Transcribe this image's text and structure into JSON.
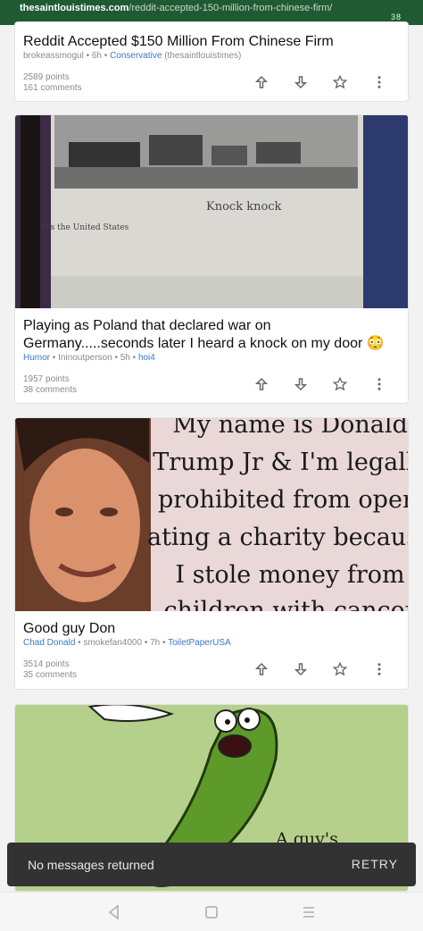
{
  "browser": {
    "url_domain": "thesaintlouistimes.com",
    "url_path": "/reddit-accepted-150-million-from-chinese-firm/",
    "status_text": "38"
  },
  "posts": [
    {
      "title": "Reddit Accepted $150 Million From Chinese Firm",
      "author": "brokeassmogul",
      "age": "6h",
      "subreddit": "Conservative",
      "source": "(thesaintlouistimes)",
      "points": "2589 points",
      "comments": "161 comments"
    },
    {
      "title": "Playing as Poland that declared war on Germany.....seconds later I heard a knock on my door 😳",
      "flair": "Humor",
      "author": "Ininoutperson",
      "age": "5h",
      "subreddit": "hoi4",
      "points": "1957 points",
      "comments": "38 comments",
      "image_text_main": "Knock knock",
      "image_text_sub": "It's the United States"
    },
    {
      "title": "Good guy Don",
      "flair": "Chad Donald",
      "author": "smokefan4000",
      "age": "7h",
      "subreddit": "ToiletPaperUSA",
      "points": "3514 points",
      "comments": "35 comments",
      "image_text_lines": [
        "My name is Donald",
        "Trump Jr & I'm legally",
        "prohibited from oper-",
        "ating a charity because",
        "I stole money from",
        "children with cancer"
      ]
    },
    {
      "image_text": "A guy's"
    }
  ],
  "snackbar": {
    "message": "No messages returned",
    "action": "RETRY"
  },
  "colors": {
    "link": "#3a78c9",
    "topbar": "#1f5a33",
    "snackbar": "#323232"
  }
}
